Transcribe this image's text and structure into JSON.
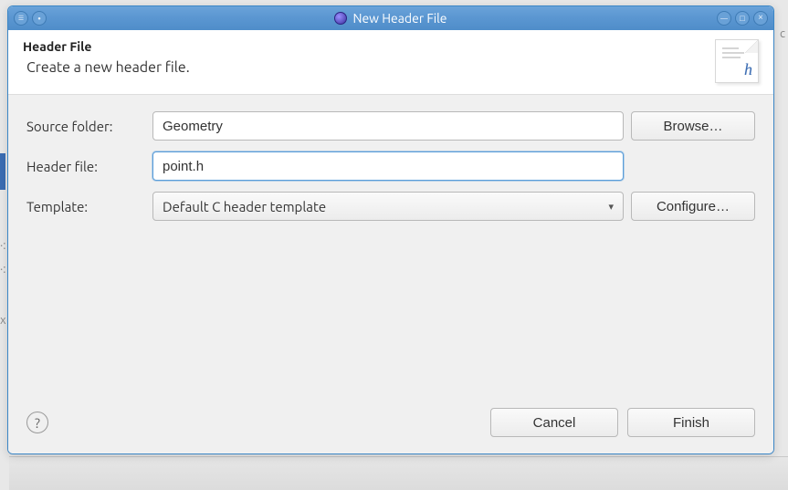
{
  "window": {
    "title": "New Header File"
  },
  "header": {
    "title": "Header File",
    "subtitle": "Create a new header file."
  },
  "form": {
    "source_folder": {
      "label": "Source folder:",
      "value": "Geometry",
      "browse": "Browse…"
    },
    "header_file": {
      "label": "Header file:",
      "value": "point.h"
    },
    "template": {
      "label": "Template:",
      "selected": "Default C header template",
      "configure": "Configure…"
    }
  },
  "footer": {
    "help": "?",
    "cancel": "Cancel",
    "finish": "Finish"
  },
  "bg": {
    "letter_c": "c",
    "letter_x": "x"
  }
}
